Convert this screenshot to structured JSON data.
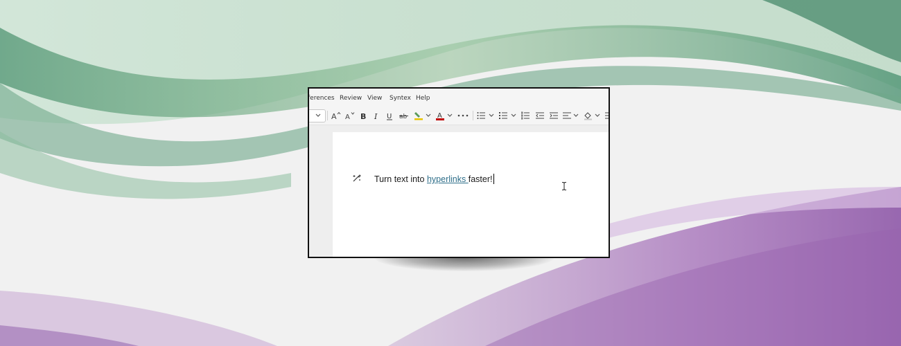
{
  "menu": {
    "items": [
      "ferences",
      "Review",
      "View",
      "Syntex",
      "Help"
    ]
  },
  "ribbon": {
    "buttons": [
      {
        "name": "font-size-dropdown-chevron-icon"
      },
      {
        "name": "increase-font-size-icon",
        "glyph": "A^"
      },
      {
        "name": "decrease-font-size-icon",
        "glyph": "A˅"
      },
      {
        "name": "bold-icon",
        "glyph": "B"
      },
      {
        "name": "italic-icon",
        "glyph": "I"
      },
      {
        "name": "underline-icon",
        "glyph": "U"
      },
      {
        "name": "strikethrough-icon",
        "glyph": "ab"
      },
      {
        "name": "highlight-icon"
      },
      {
        "name": "font-color-icon",
        "glyph": "A"
      },
      {
        "name": "more-options-icon",
        "glyph": "•••"
      },
      {
        "name": "bullets-icon"
      },
      {
        "name": "numbering-icon"
      },
      {
        "name": "checklist-icon"
      },
      {
        "name": "decrease-indent-icon"
      },
      {
        "name": "increase-indent-icon"
      },
      {
        "name": "align-icon"
      },
      {
        "name": "shading-icon"
      }
    ],
    "colors": {
      "highlight": "#e8c400",
      "font_color": "#c00000"
    }
  },
  "document": {
    "text_before": "Turn text into ",
    "link_text": "hyperlinks ",
    "text_after": "faster!",
    "link_color": "#2f6f8a"
  }
}
